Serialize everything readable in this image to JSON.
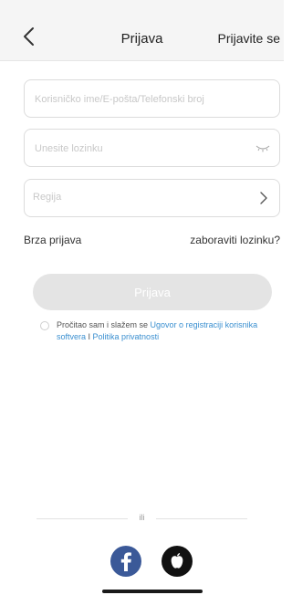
{
  "header": {
    "title": "Prijava",
    "register_label": "Prijavite se"
  },
  "form": {
    "username_placeholder": "Korisničko ime/E-pošta/Telefonski broj",
    "password_placeholder": "Unesite lozinku",
    "region_label": "Regija"
  },
  "links": {
    "quick_login": "Brza prijava",
    "forgot_password": "zaboraviti lozinku?"
  },
  "login_button": "Prijava",
  "agreement": {
    "prefix": "Pročitao sam i slažem se ",
    "user_agreement": "Ugovor o registraciji korisnika softvera",
    "separator": " I ",
    "privacy_policy": "Politika privatnosti"
  },
  "divider_text": "ili",
  "colors": {
    "link": "#3a8fd0",
    "facebook": "#3b5998",
    "button_disabled": "#e4e4e4"
  },
  "icons": [
    "back-arrow-icon",
    "eye-closed-icon",
    "chevron-right-icon",
    "facebook-icon",
    "apple-icon"
  ]
}
